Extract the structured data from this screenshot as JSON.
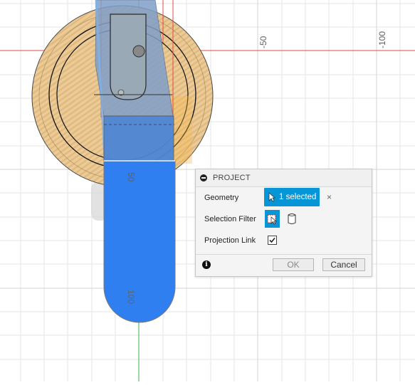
{
  "viewport": {
    "dimension_labels": {
      "top_neg50": "-50",
      "top_neg100": "-100",
      "side_50": "50",
      "side_100": "100"
    },
    "colors": {
      "grid": "#e6e6e6",
      "x_axis": "#e04a4a",
      "y_axis": "#39b54a",
      "wood": "#e9c690",
      "selection_blue": "#2f7ff0",
      "ghost_blue": "#8aa8cf"
    }
  },
  "dialog": {
    "title": "PROJECT",
    "geometry_label": "Geometry",
    "geometry_value": "1 selected",
    "clear_symbol": "×",
    "selection_filter_label": "Selection Filter",
    "projection_link_label": "Projection Link",
    "projection_link_checked": true,
    "info_symbol": "i",
    "ok_label": "OK",
    "cancel_label": "Cancel"
  }
}
